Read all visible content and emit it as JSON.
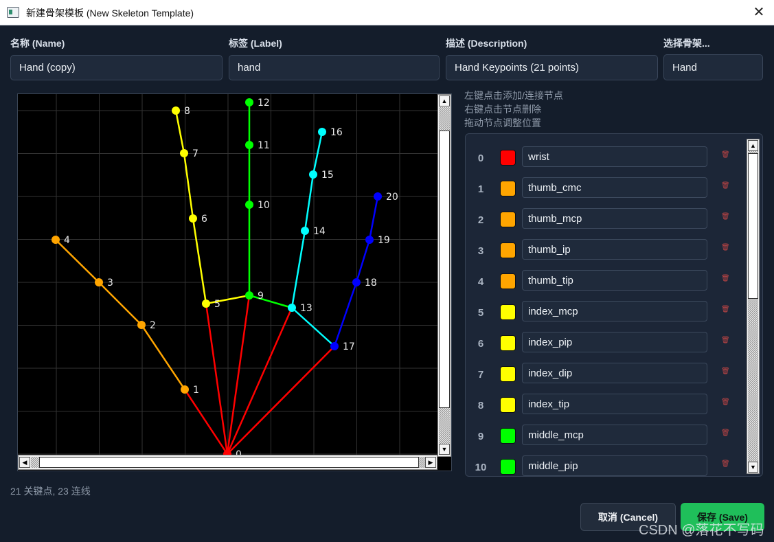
{
  "window": {
    "title": "新建骨架模板 (New Skeleton Template)"
  },
  "form": {
    "name_label": "名称 (Name)",
    "name_value": "Hand (copy)",
    "label_label": "标签 (Label)",
    "label_value": "hand",
    "desc_label": "描述 (Description)",
    "desc_value": "Hand Keypoints (21 points)",
    "select_label": "选择骨架...",
    "select_value": "Hand"
  },
  "help": {
    "line1": "左键点击添加/连接节点",
    "line2": "右键点击节点删除",
    "line3": "拖动节点调整位置"
  },
  "keypoints": [
    {
      "index": "0",
      "name": "wrist",
      "color": "#ff0000"
    },
    {
      "index": "1",
      "name": "thumb_cmc",
      "color": "#ffa500"
    },
    {
      "index": "2",
      "name": "thumb_mcp",
      "color": "#ffa500"
    },
    {
      "index": "3",
      "name": "thumb_ip",
      "color": "#ffa500"
    },
    {
      "index": "4",
      "name": "thumb_tip",
      "color": "#ffa500"
    },
    {
      "index": "5",
      "name": "index_mcp",
      "color": "#ffff00"
    },
    {
      "index": "6",
      "name": "index_pip",
      "color": "#ffff00"
    },
    {
      "index": "7",
      "name": "index_dip",
      "color": "#ffff00"
    },
    {
      "index": "8",
      "name": "index_tip",
      "color": "#ffff00"
    },
    {
      "index": "9",
      "name": "middle_mcp",
      "color": "#00ff00"
    },
    {
      "index": "10",
      "name": "middle_pip",
      "color": "#00ff00"
    }
  ],
  "skeleton_labels": [
    "0",
    "1",
    "2",
    "3",
    "4",
    "5",
    "6",
    "7",
    "8",
    "9",
    "10",
    "11",
    "12",
    "13",
    "14",
    "15",
    "16",
    "17",
    "18",
    "19",
    "20"
  ],
  "status": {
    "text": "21 关键点, 23 连线"
  },
  "buttons": {
    "cancel": "取消 (Cancel)",
    "save": "保存 (Save)"
  },
  "watermark": {
    "text": "CSDN @落花不写码"
  },
  "colors": {
    "wrist": "#ff0000",
    "thumb": "#ffa500",
    "index": "#ffff00",
    "middle": "#00ff00",
    "ring": "#00ffff",
    "pinky": "#0000ff",
    "accent": "#1fbf5a",
    "background": "#141d2b"
  },
  "icons": {
    "close": "close-icon",
    "delete": "trash-icon",
    "app": "window-icon"
  }
}
